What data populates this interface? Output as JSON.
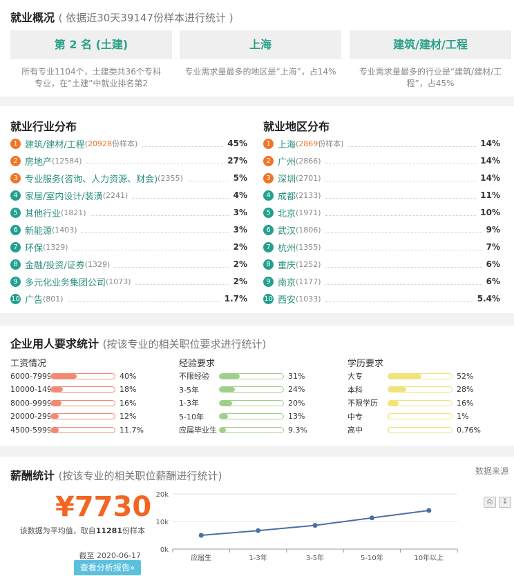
{
  "overview": {
    "title": "就业概况",
    "subtitle": "( 依据近30天39147份样本进行统计 )",
    "boxes": [
      {
        "label": "第 2 名 (土建)",
        "desc": "所有专业1104个，土建类共36个专科专业，在“土建”中就业排名第2"
      },
      {
        "label": "上海",
        "desc": "专业需求量最多的地区是“上海”，占14%"
      },
      {
        "label": "建筑/建材/工程",
        "desc": "专业需求量最多的行业是“建筑/建材/工程”，占45%"
      }
    ]
  },
  "industry": {
    "title": "就业行业分布",
    "items": [
      {
        "rank": "1",
        "name": "建筑/建材/工程",
        "count": "20928",
        "count_suffix": "份样本)",
        "pct": "45%"
      },
      {
        "rank": "2",
        "name": "房地产",
        "count": "(12584)",
        "pct": "27%"
      },
      {
        "rank": "3",
        "name": "专业服务(咨询、人力资源、财会)",
        "count": "(2355)",
        "pct": "5%"
      },
      {
        "rank": "4",
        "name": "家居/室内设计/装潢",
        "count": "(2241)",
        "pct": "4%"
      },
      {
        "rank": "5",
        "name": "其他行业",
        "count": "(1821)",
        "pct": "3%"
      },
      {
        "rank": "6",
        "name": "新能源",
        "count": "(1403)",
        "pct": "3%"
      },
      {
        "rank": "7",
        "name": "环保",
        "count": "(1329)",
        "pct": "2%"
      },
      {
        "rank": "8",
        "name": "金融/投资/证券",
        "count": "(1329)",
        "pct": "2%"
      },
      {
        "rank": "9",
        "name": "多元化业务集团公司",
        "count": "(1073)",
        "pct": "2%"
      },
      {
        "rank": "10",
        "name": "广告",
        "count": "(801)",
        "pct": "1.7%"
      }
    ]
  },
  "region": {
    "title": "就业地区分布",
    "items": [
      {
        "rank": "1",
        "name": "上海",
        "count": "2869",
        "count_suffix": "份样本)",
        "pct": "14%"
      },
      {
        "rank": "2",
        "name": "广州",
        "count": "(2866)",
        "pct": "14%"
      },
      {
        "rank": "3",
        "name": "深圳",
        "count": "(2701)",
        "pct": "14%"
      },
      {
        "rank": "4",
        "name": "成都",
        "count": "(2133)",
        "pct": "11%"
      },
      {
        "rank": "5",
        "name": "北京",
        "count": "(1971)",
        "pct": "10%"
      },
      {
        "rank": "6",
        "name": "武汉",
        "count": "(1806)",
        "pct": "9%"
      },
      {
        "rank": "7",
        "name": "杭州",
        "count": "(1355)",
        "pct": "7%"
      },
      {
        "rank": "8",
        "name": "重庆",
        "count": "(1252)",
        "pct": "6%"
      },
      {
        "rank": "9",
        "name": "南京",
        "count": "(1177)",
        "pct": "6%"
      },
      {
        "rank": "10",
        "name": "西安",
        "count": "(1033)",
        "pct": "5.4%"
      }
    ]
  },
  "requirements": {
    "title": "企业用人要求统计",
    "subtitle": "(按该专业的相关职位要求进行统计)",
    "salary": {
      "title": "工资情况",
      "color": "#f08a75",
      "rows": [
        {
          "label": "6000-7999",
          "pct": "40%",
          "value": 40
        },
        {
          "label": "10000-149",
          "pct": "18%",
          "value": 18
        },
        {
          "label": "8000-9999",
          "pct": "16%",
          "value": 16
        },
        {
          "label": "20000-299",
          "pct": "12%",
          "value": 12
        },
        {
          "label": "4500-5999",
          "pct": "11.7%",
          "value": 11.7
        }
      ]
    },
    "experience": {
      "title": "经验要求",
      "color": "#9fd08a",
      "rows": [
        {
          "label": "不限经验",
          "pct": "31%",
          "value": 31
        },
        {
          "label": "3-5年",
          "pct": "24%",
          "value": 24
        },
        {
          "label": "1-3年",
          "pct": "20%",
          "value": 20
        },
        {
          "label": "5-10年",
          "pct": "13%",
          "value": 13
        },
        {
          "label": "应届毕业生",
          "pct": "9.3%",
          "value": 9.3
        }
      ]
    },
    "education": {
      "title": "学历要求",
      "color": "#f2e27a",
      "rows": [
        {
          "label": "大专",
          "pct": "52%",
          "value": 52
        },
        {
          "label": "本科",
          "pct": "28%",
          "value": 28
        },
        {
          "label": "不限学历",
          "pct": "16%",
          "value": 16
        },
        {
          "label": "中专",
          "pct": "1%",
          "value": 1
        },
        {
          "label": "高中",
          "pct": "0.76%",
          "value": 0.76
        }
      ]
    }
  },
  "pay": {
    "title": "薪酬统计",
    "subtitle": "(按该专业的相关职位薪酬进行统计)",
    "source_link": "数据来源",
    "amount": "¥7730",
    "note_prefix": "该数据为平均值，取自",
    "note_count": "11281",
    "note_suffix": "份样本",
    "date": "截至 2020-06-17",
    "report_button": "查看分析报告»",
    "print_icon": "print-icon",
    "download_icon": "download-icon"
  },
  "chart_data": {
    "type": "line",
    "categories": [
      "应届生",
      "1-3年",
      "3-5年",
      "5-10年",
      "10年以上"
    ],
    "values": [
      5000,
      6700,
      8600,
      11300,
      14000
    ],
    "yticks": [
      "0k",
      "10k",
      "20k"
    ],
    "ylim": [
      0,
      20000
    ],
    "color": "#4a6fa5",
    "grid": true
  }
}
